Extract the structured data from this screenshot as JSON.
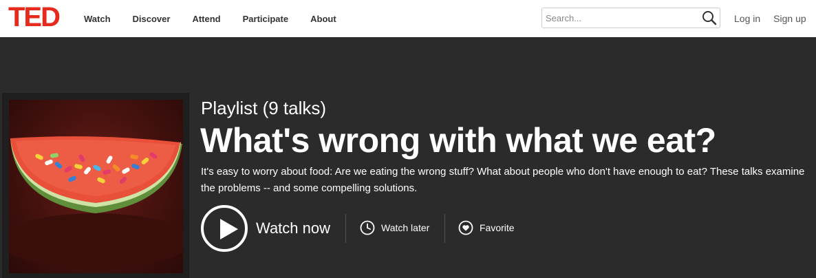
{
  "brand": {
    "logo_text": "TED",
    "color": "#e62b1e"
  },
  "nav": {
    "items": [
      {
        "label": "Watch"
      },
      {
        "label": "Discover"
      },
      {
        "label": "Attend"
      },
      {
        "label": "Participate"
      },
      {
        "label": "About"
      }
    ]
  },
  "search": {
    "placeholder": "Search...",
    "value": "",
    "icon": "search-icon"
  },
  "auth": {
    "login_label": "Log in",
    "signup_label": "Sign up"
  },
  "playlist": {
    "kicker": "Playlist (9 talks)",
    "title": "What's wrong with what we eat?",
    "description": "It's easy to worry about food: Are we eating the wrong stuff? What about people who don't have enough to eat? These talks examine the problems -- and some compelling solutions.",
    "image_alt": "Watermelon slice filled with pills",
    "actions": {
      "watch_now_label": "Watch now",
      "watch_later_label": "Watch later",
      "favorite_label": "Favorite"
    }
  },
  "colors": {
    "hero_bg": "#2b2b2b",
    "header_bg": "#ffffff",
    "accent": "#e62b1e"
  }
}
